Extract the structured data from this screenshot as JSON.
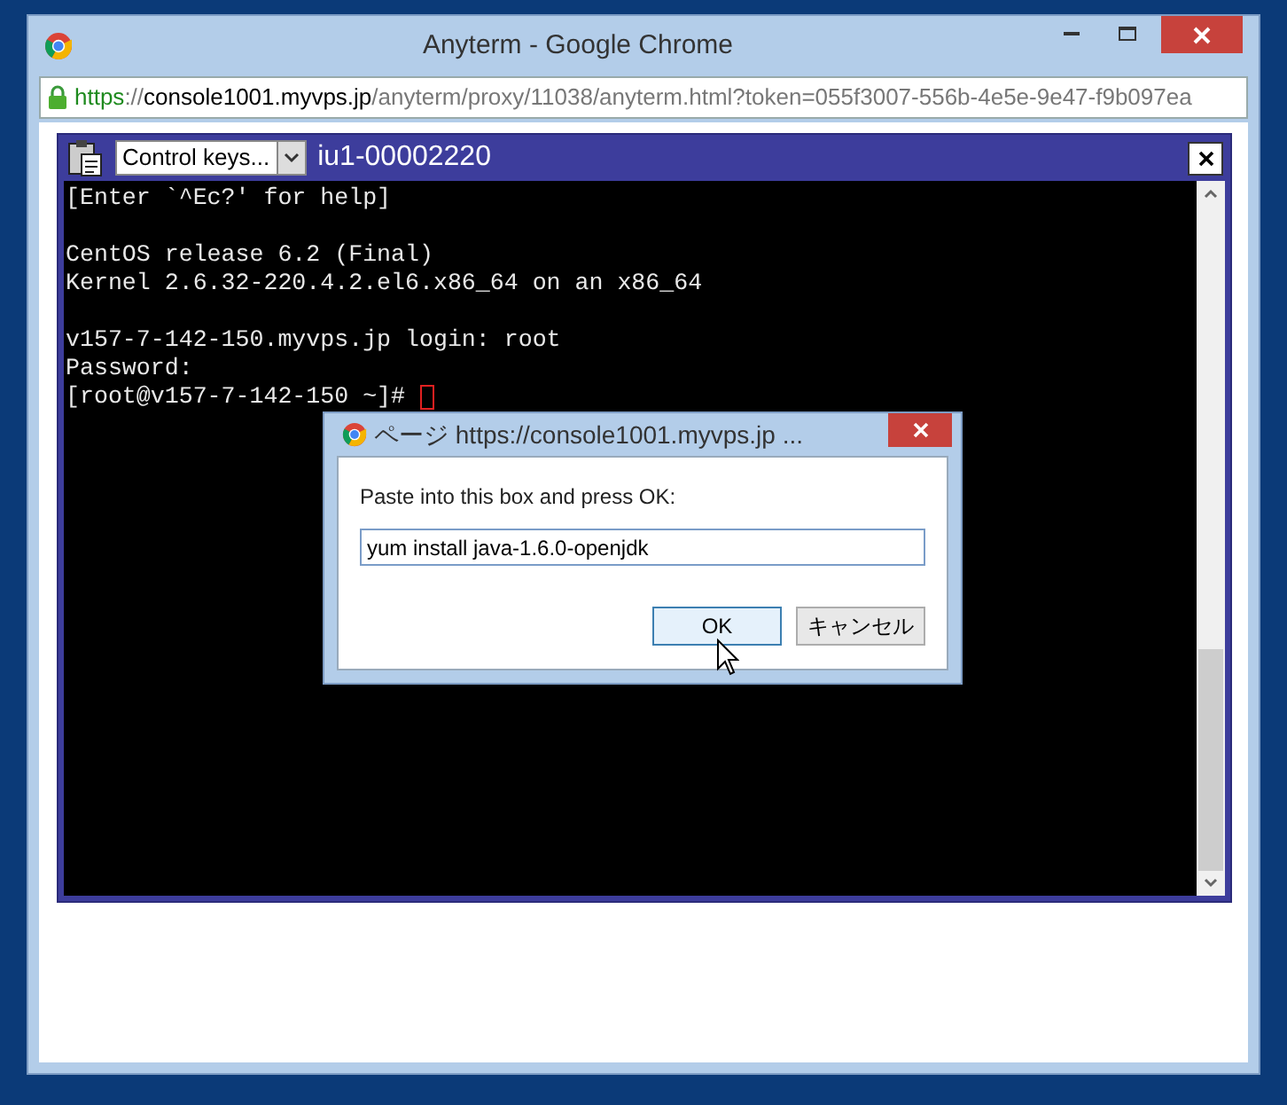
{
  "window": {
    "title": "Anyterm - Google Chrome"
  },
  "address_bar": {
    "parts": [
      {
        "kind": "scheme",
        "text": "https"
      },
      {
        "kind": "dim",
        "text": "://"
      },
      {
        "kind": "host",
        "text": "console1001.myvps.jp"
      },
      {
        "kind": "dim",
        "text": "/anyterm/proxy/11038/anyterm.html?token=055f3007-556b-4e5e-9e47-f9b097ea"
      }
    ]
  },
  "console": {
    "control_select": "Control keys...",
    "title": "iu1-00002220",
    "paragraphs": [
      [
        "[Enter `^Ec?' for help]"
      ],
      [
        "CentOS release 6.2 (Final)",
        "Kernel 2.6.32-220.4.2.el6.x86_64 on an x86_64"
      ],
      [
        "v157-7-142-150.myvps.jp login: root",
        "Password:",
        "[root@v157-7-142-150 ~]# "
      ]
    ],
    "cursor": true
  },
  "dialog": {
    "title": "ページ https://console1001.myvps.jp ...",
    "prompt": "Paste into this box and press OK:",
    "value": "yum install java-1.6.0-openjdk",
    "buttons": [
      {
        "label": "OK",
        "focused": true
      },
      {
        "label": "キャンセル",
        "focused": false
      }
    ]
  }
}
